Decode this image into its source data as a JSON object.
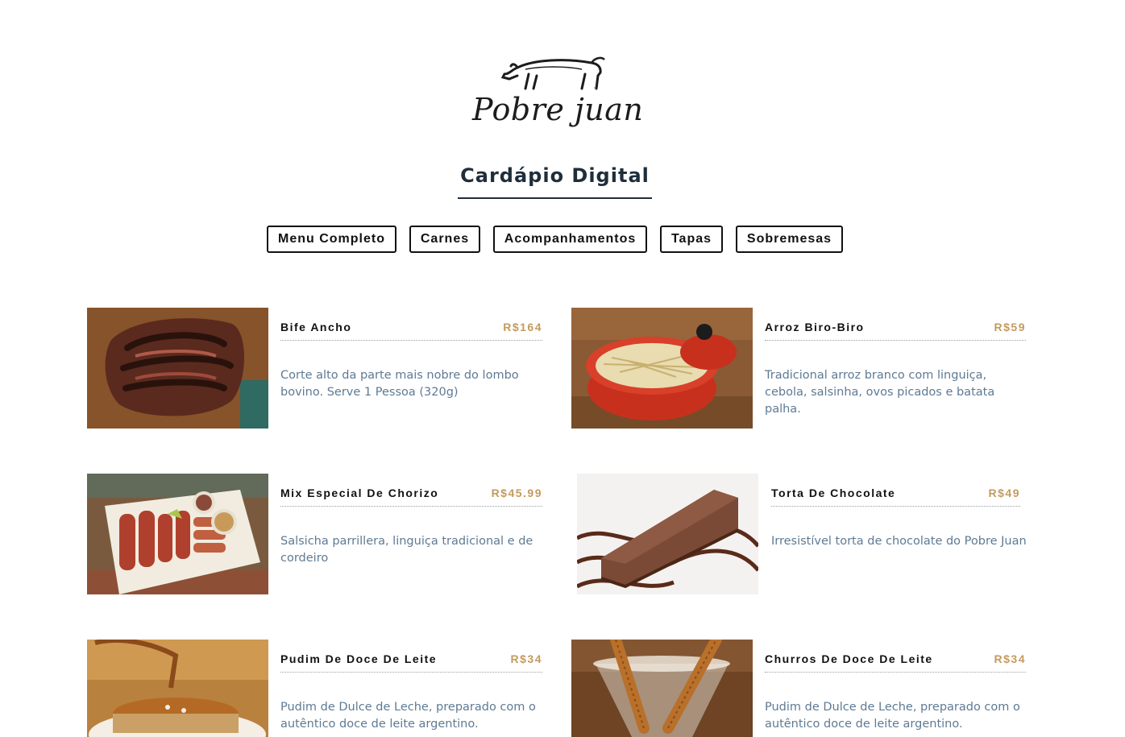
{
  "brand": {
    "name": "Pobre juan",
    "tm": "™"
  },
  "title": "Cardápio Digital",
  "nav": [
    {
      "label": "Menu Completo"
    },
    {
      "label": "Carnes"
    },
    {
      "label": "Acompanhamentos"
    },
    {
      "label": "Tapas"
    },
    {
      "label": "Sobremesas"
    }
  ],
  "items": [
    {
      "name": "Bife Ancho",
      "price": "R$164",
      "description": "Corte alto da parte mais nobre do lombo bovino. Serve 1 Pessoa (320g)",
      "image": "steak-photo"
    },
    {
      "name": "Arroz Biro-Biro",
      "price": "R$59",
      "description": "Tradicional arroz branco com linguiça, cebola, salsinha, ovos picados e batata palha.",
      "image": "rice-pot-photo"
    },
    {
      "name": "Mix Especial De Chorizo",
      "price": "R$45.99",
      "description": "Salsicha parrillera, linguiça tradicional e de cordeiro",
      "image": "sausage-platter-photo"
    },
    {
      "name": "Torta De Chocolate",
      "price": "R$49",
      "description": "Irresistível torta de chocolate do Pobre Juan",
      "image": "chocolate-cake-photo"
    },
    {
      "name": "Pudim De Doce De Leite",
      "price": "R$34",
      "description": "Pudim de Dulce de Leche, preparado com o autêntico doce de leite argentino.",
      "image": "flan-photo"
    },
    {
      "name": "Churros De Doce De Leite",
      "price": "R$34",
      "description": "Pudim de Dulce de Leche, preparado com o autêntico doce de leite argentino.",
      "image": "churros-photo"
    }
  ]
}
